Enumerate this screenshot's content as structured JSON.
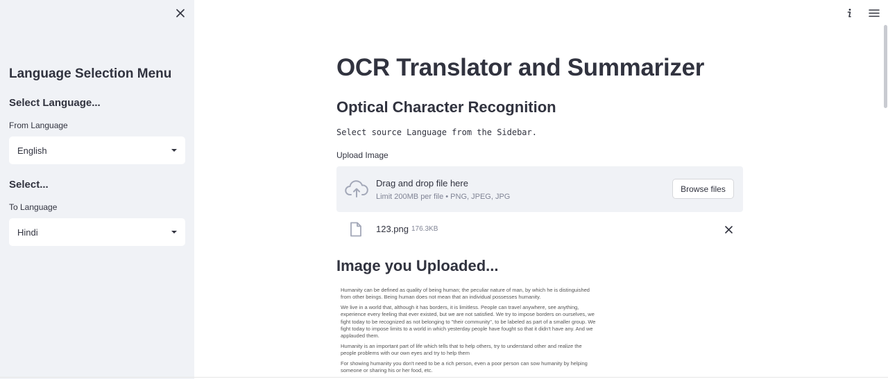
{
  "sidebar": {
    "close_icon": "close-icon",
    "heading": "Language Selection Menu",
    "from_section": {
      "subheading": "Select Language...",
      "label": "From Language",
      "selected": "English"
    },
    "to_section": {
      "subheading": "Select...",
      "label": "To Language",
      "selected": "Hindi"
    }
  },
  "toolbar": {
    "icons": [
      "info-icon",
      "hamburger-menu-icon"
    ]
  },
  "main": {
    "title": "OCR Translator and Summarizer",
    "section_ocr": "Optical Character Recognition",
    "instruction": "Select source Language from the Sidebar.",
    "upload": {
      "label": "Upload Image",
      "dropzone_title": "Drag and drop file here",
      "dropzone_limit": "Limit 200MB per file • PNG, JPEG, JPG",
      "browse_label": "Browse files",
      "file_name": "123.png",
      "file_size": "176.3KB"
    },
    "section_uploaded": "Image you Uploaded...",
    "uploaded_image_text": [
      "Humanity can be defined as quality of being human; the peculiar nature of man, by which he is distinguished from other beings. Being human does not mean that an individual possesses humanity.",
      "We live in a world that, although it has borders, it is limitless. People can travel anywhere, see anything, experience every feeling that ever existed, but we are not satisfied. We try to impose borders on ourselves, we fight today to be recognized as not belonging to \"their community\", to be labeled as part of a smaller group. We fight today to impose limits to a world in which yesterday people have fought so that it didn't have any. And we applauded them.",
      "Humanity is an important part of life which tells that to help others, try to understand other and realize the people problems with our own eyes and try to help them",
      "For showing humanity you don't need to be a rich person, even a poor person can sow humanity by helping someone or sharing his or her food, etc."
    ]
  },
  "colors": {
    "sidebar_bg": "#f0f2f6",
    "text": "#31333f",
    "muted_text": "#808495",
    "icon_accent": "#a3a8b8"
  }
}
